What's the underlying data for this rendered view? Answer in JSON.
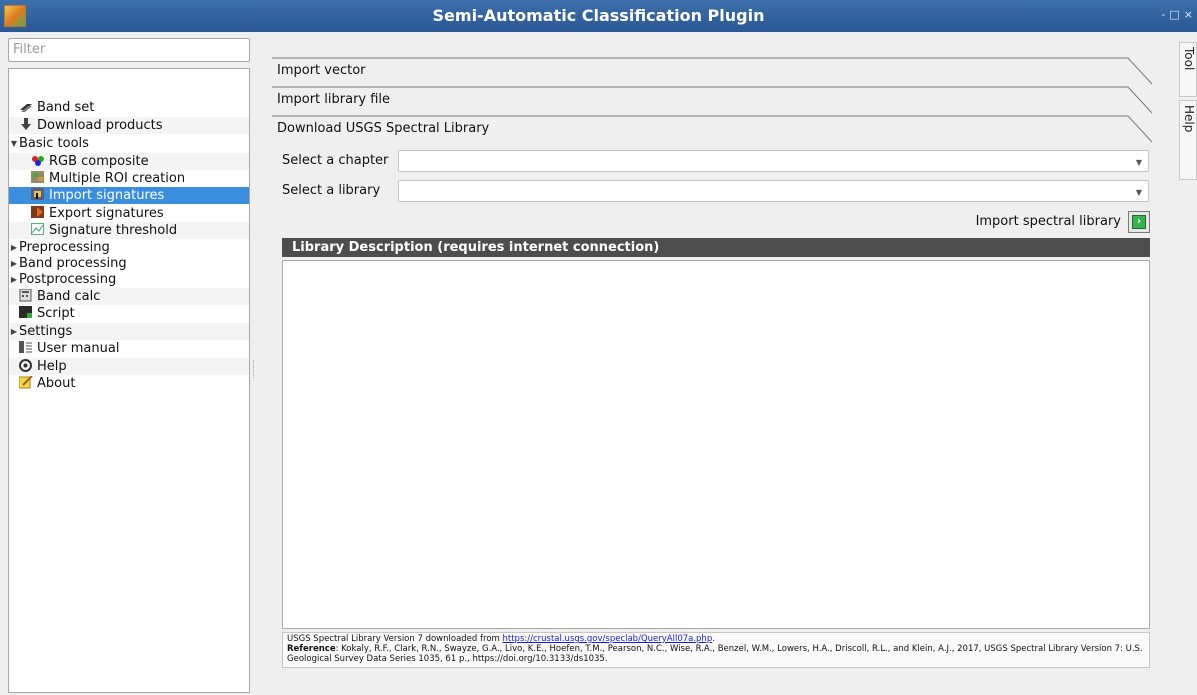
{
  "window": {
    "title": "Semi-Automatic Classification Plugin",
    "buttons": "- □ ×"
  },
  "filter": {
    "placeholder": "Filter"
  },
  "tree": {
    "items": [
      {
        "label": "Band set",
        "icon": "band-set-icon",
        "level": 1
      },
      {
        "label": "Download products",
        "icon": "download-icon",
        "level": 1
      },
      {
        "label": "Basic tools",
        "icon": "",
        "level": 0,
        "expanded": true
      },
      {
        "label": "RGB composite",
        "icon": "rgb-composite-icon",
        "level": 2
      },
      {
        "label": "Multiple ROI creation",
        "icon": "multiple-roi-icon",
        "level": 2
      },
      {
        "label": "Import signatures",
        "icon": "import-signatures-icon",
        "level": 2,
        "selected": true
      },
      {
        "label": "Export signatures",
        "icon": "export-signatures-icon",
        "level": 2
      },
      {
        "label": "Signature threshold",
        "icon": "signature-threshold-icon",
        "level": 2
      },
      {
        "label": "Preprocessing",
        "icon": "",
        "level": 0,
        "expanded": false
      },
      {
        "label": "Band processing",
        "icon": "",
        "level": 0,
        "expanded": false
      },
      {
        "label": "Postprocessing",
        "icon": "",
        "level": 0,
        "expanded": false
      },
      {
        "label": "Band calc",
        "icon": "band-calc-icon",
        "level": 1
      },
      {
        "label": "Script",
        "icon": "script-icon",
        "level": 1
      },
      {
        "label": "Settings",
        "icon": "",
        "level": 0,
        "expanded": false
      },
      {
        "label": "User manual",
        "icon": "user-manual-icon",
        "level": 1
      },
      {
        "label": "Help",
        "icon": "help-icon",
        "level": 1
      },
      {
        "label": "About",
        "icon": "about-icon",
        "level": 1
      }
    ]
  },
  "side_tabs": {
    "tool": "Tool",
    "help": "Help"
  },
  "sections": {
    "import_vector": "Import vector",
    "import_library_file": "Import library file",
    "download_usgs": "Download USGS Spectral Library"
  },
  "form": {
    "chapter_label": "Select a chapter",
    "chapter_value": "",
    "library_label": "Select a library",
    "library_value": "",
    "import_label": "Import spectral library"
  },
  "description": {
    "header": "Library Description (requires internet connection)",
    "body": ""
  },
  "reference": {
    "line1_prefix": "USGS Spectral Library Version 7 downloaded from ",
    "line1_link": "https://crustal.usgs.gov/speclab/QueryAll07a.php",
    "line1_suffix": ".",
    "ref_label": "Reference",
    "ref_text": ": Kokaly, R.F., Clark, R.N., Swayze, G.A., Livo, K.E., Hoefen, T.M., Pearson, N.C., Wise, R.A., Benzel, W.M., Lowers, H.A., Driscoll, R.L., and Klein, A.J., 2017, USGS Spectral Library Version 7: U.S. Geological Survey Data Series 1035, 61 p., https://doi.org/10.3133/ds1035."
  },
  "colors": {
    "titlebar": "#2f62a0",
    "selection": "#3b8ede",
    "desc_header": "#4d4d4d"
  }
}
